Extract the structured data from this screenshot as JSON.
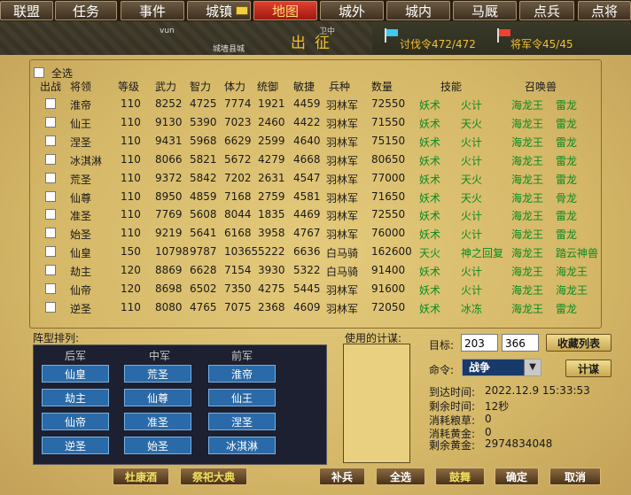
{
  "nav": [
    "联盟",
    "任务",
    "事件",
    "城镇",
    "地图",
    "城外",
    "城内",
    "马厩",
    "点兵",
    "点将"
  ],
  "header": {
    "title": "出征",
    "crusade_order": "讨伐令472/472",
    "general_order": "将军令45/45",
    "map_texts": [
      "vun",
      "城墙县城",
      "卫中"
    ]
  },
  "table": {
    "select_all": "全选",
    "headers": [
      "出战",
      "将领",
      "等级",
      "武力",
      "智力",
      "体力",
      "统御",
      "敏捷",
      "兵种",
      "数量",
      "技能",
      "召唤兽"
    ],
    "rows": [
      {
        "name": "淮帝",
        "level": "110",
        "str": "8252",
        "int": "4725",
        "vit": "7774",
        "lead": "1921",
        "agi": "4459",
        "troop": "羽林军",
        "count": "72550",
        "skill1": "妖术",
        "skill2": "火计",
        "beast1": "海龙王",
        "beast2": "雷龙"
      },
      {
        "name": "仙王",
        "level": "110",
        "str": "9130",
        "int": "5390",
        "vit": "7023",
        "lead": "2460",
        "agi": "4422",
        "troop": "羽林军",
        "count": "71550",
        "skill1": "妖术",
        "skill2": "天火",
        "beast1": "海龙王",
        "beast2": "雷龙"
      },
      {
        "name": "涅圣",
        "level": "110",
        "str": "9431",
        "int": "5968",
        "vit": "6629",
        "lead": "2599",
        "agi": "4640",
        "troop": "羽林军",
        "count": "75150",
        "skill1": "妖术",
        "skill2": "火计",
        "beast1": "海龙王",
        "beast2": "雷龙"
      },
      {
        "name": "冰淇淋",
        "level": "110",
        "str": "8066",
        "int": "5821",
        "vit": "5672",
        "lead": "4279",
        "agi": "4668",
        "troop": "羽林军",
        "count": "80650",
        "skill1": "妖术",
        "skill2": "火计",
        "beast1": "海龙王",
        "beast2": "雷龙"
      },
      {
        "name": "荒圣",
        "level": "110",
        "str": "9372",
        "int": "5842",
        "vit": "7202",
        "lead": "2631",
        "agi": "4547",
        "troop": "羽林军",
        "count": "77000",
        "skill1": "妖术",
        "skill2": "天火",
        "beast1": "海龙王",
        "beast2": "雷龙"
      },
      {
        "name": "仙尊",
        "level": "110",
        "str": "8950",
        "int": "4859",
        "vit": "7168",
        "lead": "2759",
        "agi": "4581",
        "troop": "羽林军",
        "count": "71650",
        "skill1": "妖术",
        "skill2": "天火",
        "beast1": "海龙王",
        "beast2": "骨龙"
      },
      {
        "name": "准圣",
        "level": "110",
        "str": "7769",
        "int": "5608",
        "vit": "8044",
        "lead": "1835",
        "agi": "4469",
        "troop": "羽林军",
        "count": "72550",
        "skill1": "妖术",
        "skill2": "火计",
        "beast1": "海龙王",
        "beast2": "雷龙"
      },
      {
        "name": "始圣",
        "level": "110",
        "str": "9219",
        "int": "5641",
        "vit": "6168",
        "lead": "3958",
        "agi": "4767",
        "troop": "羽林军",
        "count": "76000",
        "skill1": "妖术",
        "skill2": "火计",
        "beast1": "海龙王",
        "beast2": "雷龙"
      },
      {
        "name": "仙皇",
        "level": "150",
        "str": "10798",
        "int": "9787",
        "vit": "10365",
        "lead": "5222",
        "agi": "6636",
        "troop": "白马骑",
        "count": "162600",
        "skill1": "天火",
        "skill2": "神之回复",
        "beast1": "海龙王",
        "beast2": "踏云神兽"
      },
      {
        "name": "劫主",
        "level": "120",
        "str": "8869",
        "int": "6628",
        "vit": "7154",
        "lead": "3930",
        "agi": "5322",
        "troop": "白马骑",
        "count": "91400",
        "skill1": "妖术",
        "skill2": "火计",
        "beast1": "海龙王",
        "beast2": "海龙王"
      },
      {
        "name": "仙帝",
        "level": "120",
        "str": "8698",
        "int": "6502",
        "vit": "7350",
        "lead": "4275",
        "agi": "5445",
        "troop": "羽林军",
        "count": "91600",
        "skill1": "妖术",
        "skill2": "火计",
        "beast1": "海龙王",
        "beast2": "海龙王"
      },
      {
        "name": "逆圣",
        "level": "110",
        "str": "8080",
        "int": "4765",
        "vit": "7075",
        "lead": "2368",
        "agi": "4609",
        "troop": "羽林军",
        "count": "72050",
        "skill1": "妖术",
        "skill2": "冰冻",
        "beast1": "海龙王",
        "beast2": "雷龙"
      }
    ]
  },
  "formation": {
    "label": "阵型排列:",
    "headers": [
      "后军",
      "中军",
      "前军"
    ],
    "grid": [
      [
        "仙皇",
        "荒圣",
        "淮帝"
      ],
      [
        "劫主",
        "仙尊",
        "仙王"
      ],
      [
        "仙帝",
        "准圣",
        "涅圣"
      ],
      [
        "逆圣",
        "始圣",
        "冰淇淋"
      ]
    ]
  },
  "strategy": {
    "label": "使用的计谋:"
  },
  "target": {
    "label": "目标:",
    "x": "203",
    "y": "366",
    "fav_button": "收藏列表"
  },
  "command": {
    "label": "命令:",
    "value": "战争",
    "plan_button": "计谋"
  },
  "info": {
    "arrival_label": "到达时间:",
    "arrival": "2022.12.9  15:33:53",
    "remain_label": "剩余时间:",
    "remain": "12秒",
    "food_label": "消耗粮草:",
    "food": "0",
    "gold_label": "消耗黄金:",
    "gold": "0",
    "left_gold_label": "剩余黄金:",
    "left_gold": "2974834048"
  },
  "buttons": {
    "dukang": "杜康酒",
    "sacrifice": "祭祀大典",
    "replenish": "补兵",
    "all": "全选",
    "drum": "鼓舞",
    "ok": "确定",
    "cancel": "取消"
  }
}
